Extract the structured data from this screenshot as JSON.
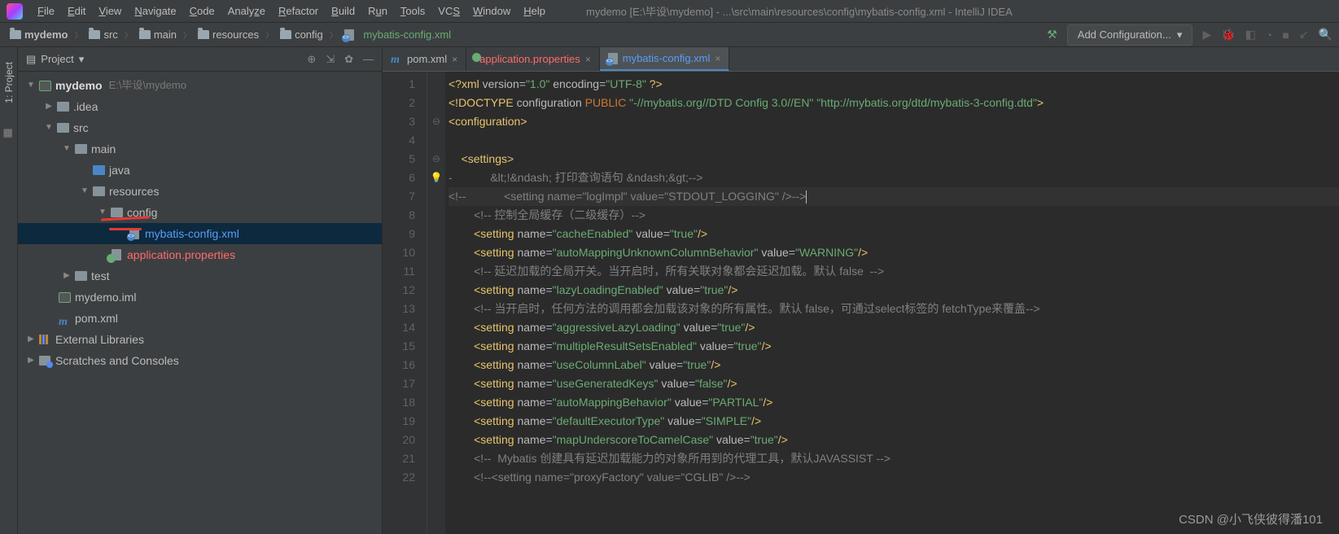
{
  "menu": {
    "items": [
      "File",
      "Edit",
      "View",
      "Navigate",
      "Code",
      "Analyze",
      "Refactor",
      "Build",
      "Run",
      "Tools",
      "VCS",
      "Window",
      "Help"
    ]
  },
  "window_title": "mydemo [E:\\毕设\\mydemo] - ...\\src\\main\\resources\\config\\mybatis-config.xml - IntelliJ IDEA",
  "breadcrumb": [
    "mydemo",
    "src",
    "main",
    "resources",
    "config",
    "mybatis-config.xml"
  ],
  "nav": {
    "config_button": "Add Configuration..."
  },
  "panel": {
    "title": "Project",
    "tree": {
      "root": "mydemo",
      "root_hint": "E:\\毕设\\mydemo",
      "idea": ".idea",
      "src": "src",
      "main": "main",
      "java": "java",
      "resources": "resources",
      "config": "config",
      "mybatis": "mybatis-config.xml",
      "appprops": "application.properties",
      "test": "test",
      "iml": "mydemo.iml",
      "pom": "pom.xml",
      "extlib": "External Libraries",
      "scratches": "Scratches and Consoles"
    }
  },
  "sidetab": {
    "project": "1: Project"
  },
  "tabs": [
    {
      "label": "pom.xml",
      "kind": "maven"
    },
    {
      "label": "application.properties",
      "kind": "error"
    },
    {
      "label": "mybatis-config.xml",
      "kind": "active"
    }
  ],
  "code": {
    "lines": [
      {
        "n": 1,
        "html": "<span class='k-tag'>&lt;?xml</span> <span class='k-attr'>version</span>=<span class='k-str'>\"1.0\"</span> <span class='k-attr'>encoding</span>=<span class='k-str'>\"UTF-8\"</span> <span class='k-tag'>?&gt;</span>"
      },
      {
        "n": 2,
        "html": "<span class='k-doctype'>&lt;!DOCTYPE</span> <span class='k-attr'>configuration</span> <span class='k-key'>PUBLIC</span> <span class='k-str'>\"-//mybatis.org//DTD Config 3.0//EN\"</span> <span class='k-str'>\"http://mybatis.org/dtd/mybatis-3-config.dtd\"</span><span class='k-doctype'>&gt;</span>"
      },
      {
        "n": 3,
        "html": "<span class='k-tag'>&lt;configuration&gt;</span>"
      },
      {
        "n": 4,
        "html": ""
      },
      {
        "n": 5,
        "html": "    <span class='k-tag'>&lt;settings&gt;</span>"
      },
      {
        "n": 6,
        "html": "<span class='k-comment'>-            &amp;lt;!&amp;ndash; 打印查询语句 &amp;ndash;&amp;gt;--&gt;</span>"
      },
      {
        "n": 7,
        "html": "<span class='k-comment'>&lt;!--            &lt;setting name=\"logImpl\" value=\"STDOUT_LOGGING\" /&gt;--&gt;</span><span class='caret'></span>",
        "cursor": true
      },
      {
        "n": 8,
        "html": "        <span class='k-comment'>&lt;!-- 控制全局缓存（二级缓存）--&gt;</span>"
      },
      {
        "n": 9,
        "html": "        <span class='k-tag'>&lt;setting</span> <span class='k-attr'>name</span>=<span class='k-str'>\"cacheEnabled\"</span> <span class='k-attr'>value</span>=<span class='k-str'>\"true\"</span><span class='k-tag'>/&gt;</span>"
      },
      {
        "n": 10,
        "html": "        <span class='k-tag'>&lt;setting</span> <span class='k-attr'>name</span>=<span class='k-str'>\"autoMappingUnknownColumnBehavior\"</span> <span class='k-attr'>value</span>=<span class='k-str'>\"WARNING\"</span><span class='k-tag'>/&gt;</span>"
      },
      {
        "n": 11,
        "html": "        <span class='k-comment'>&lt;!-- 延迟加载的全局开关。当开启时，所有关联对象都会延迟加载。默认 false  --&gt;</span>"
      },
      {
        "n": 12,
        "html": "        <span class='k-tag'>&lt;setting</span> <span class='k-attr'>name</span>=<span class='k-str'>\"lazyLoadingEnabled\"</span> <span class='k-attr'>value</span>=<span class='k-str'>\"true\"</span><span class='k-tag'>/&gt;</span>"
      },
      {
        "n": 13,
        "html": "        <span class='k-comment'>&lt;!-- 当开启时，任何方法的调用都会加载该对象的所有属性。默认 false，可通过select标签的 fetchType来覆盖--&gt;</span>"
      },
      {
        "n": 14,
        "html": "        <span class='k-tag'>&lt;setting</span> <span class='k-attr'>name</span>=<span class='k-str'>\"aggressiveLazyLoading\"</span> <span class='k-attr'>value</span>=<span class='k-str'>\"true\"</span><span class='k-tag'>/&gt;</span>"
      },
      {
        "n": 15,
        "html": "        <span class='k-tag'>&lt;setting</span> <span class='k-attr'>name</span>=<span class='k-str'>\"multipleResultSetsEnabled\"</span> <span class='k-attr'>value</span>=<span class='k-str'>\"true\"</span><span class='k-tag'>/&gt;</span>"
      },
      {
        "n": 16,
        "html": "        <span class='k-tag'>&lt;setting</span> <span class='k-attr'>name</span>=<span class='k-str'>\"useColumnLabel\"</span> <span class='k-attr'>value</span>=<span class='k-str'>\"true\"</span><span class='k-tag'>/&gt;</span>"
      },
      {
        "n": 17,
        "html": "        <span class='k-tag'>&lt;setting</span> <span class='k-attr'>name</span>=<span class='k-str'>\"useGeneratedKeys\"</span> <span class='k-attr'>value</span>=<span class='k-str'>\"false\"</span><span class='k-tag'>/&gt;</span>"
      },
      {
        "n": 18,
        "html": "        <span class='k-tag'>&lt;setting</span> <span class='k-attr'>name</span>=<span class='k-str'>\"autoMappingBehavior\"</span> <span class='k-attr'>value</span>=<span class='k-str'>\"PARTIAL\"</span><span class='k-tag'>/&gt;</span>"
      },
      {
        "n": 19,
        "html": "        <span class='k-tag'>&lt;setting</span> <span class='k-attr'>name</span>=<span class='k-str'>\"defaultExecutorType\"</span> <span class='k-attr'>value</span>=<span class='k-str'>\"SIMPLE\"</span><span class='k-tag'>/&gt;</span>"
      },
      {
        "n": 20,
        "html": "        <span class='k-tag'>&lt;setting</span> <span class='k-attr'>name</span>=<span class='k-str'>\"mapUnderscoreToCamelCase\"</span> <span class='k-attr'>value</span>=<span class='k-str'>\"true\"</span><span class='k-tag'>/&gt;</span>"
      },
      {
        "n": 21,
        "html": "        <span class='k-comment'>&lt;!--  Mybatis 创建具有延迟加载能力的对象所用到的代理工具，默认JAVASSIST --&gt;</span>"
      },
      {
        "n": 22,
        "html": "        <span class='k-comment'>&lt;!--&lt;setting name=\"proxyFactory\" value=\"CGLIB\" /&gt;--&gt;</span>"
      }
    ]
  },
  "watermark": "CSDN @小飞侠彼得潘101"
}
